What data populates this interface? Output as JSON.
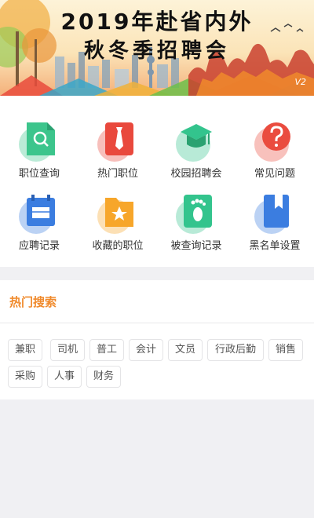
{
  "banner": {
    "line1": "2019年赴省内外",
    "line2": "秋冬季招聘会",
    "corner": "V2"
  },
  "menu": [
    {
      "label": "职位查询",
      "icon": "search-doc-icon",
      "color": "#3cc58c"
    },
    {
      "label": "热门职位",
      "icon": "tie-icon",
      "color": "#e9493d"
    },
    {
      "label": "校园招聘会",
      "icon": "graduation-cap-icon",
      "color": "#33c48d"
    },
    {
      "label": "常见问题",
      "icon": "question-icon",
      "color": "#ea4c3f"
    },
    {
      "label": "应聘记录",
      "icon": "calendar-icon",
      "color": "#3b7de0"
    },
    {
      "label": "收藏的职位",
      "icon": "star-folder-icon",
      "color": "#f7a62a"
    },
    {
      "label": "被查询记录",
      "icon": "footprint-icon",
      "color": "#33c48d"
    },
    {
      "label": "黑名单设置",
      "icon": "bookmark-book-icon",
      "color": "#3b7de0"
    }
  ],
  "hot_search": {
    "title": "热门搜索",
    "tags": [
      "兼职",
      "司机",
      "普工",
      "会计",
      "文员",
      "行政后勤",
      "销售",
      "采购",
      "人事",
      "财务"
    ]
  }
}
